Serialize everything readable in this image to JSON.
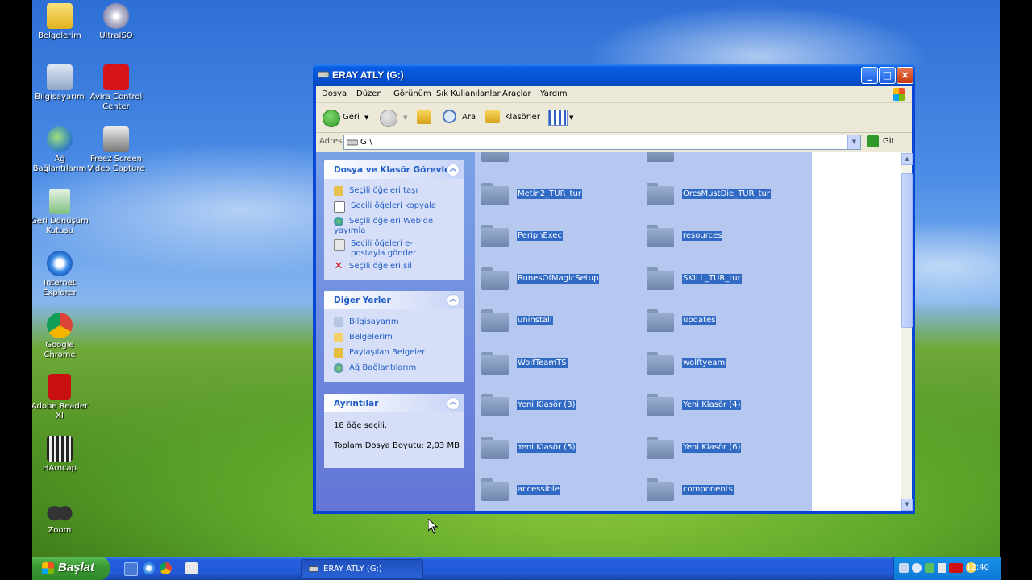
{
  "desktop": {
    "icons": [
      {
        "label": "Belgelerim",
        "icon": "my-documents-icon"
      },
      {
        "label": "UltraISO",
        "icon": "ultraiso-icon"
      },
      {
        "label": "Bilgisayarım",
        "icon": "my-computer-icon"
      },
      {
        "label": "Avira Control Center",
        "icon": "avira-icon"
      },
      {
        "label": "Ağ Bağlantılarım",
        "icon": "network-icon"
      },
      {
        "label": "Freez Screen Video Capture",
        "icon": "freez-screen-icon"
      },
      {
        "label": "Geri Dönüşüm Kutusu",
        "icon": "recycle-bin-icon"
      },
      {
        "label": "Internet Explorer",
        "icon": "internet-explorer-icon"
      },
      {
        "label": "Google Chrome",
        "icon": "chrome-icon"
      },
      {
        "label": "Adobe Reader XI",
        "icon": "adobe-reader-icon"
      },
      {
        "label": "HAmcap",
        "icon": "hamcap-icon"
      },
      {
        "label": "Zoom",
        "icon": "zoom-icon"
      }
    ]
  },
  "window": {
    "title": "ERAY ATLY (G:)",
    "menu": [
      "Dosya",
      "Düzen",
      "Görünüm",
      "Sık Kullanılanlar",
      "Araçlar",
      "Yardım"
    ],
    "toolbar": {
      "back": "Geri",
      "search": "Ara",
      "folders": "Klasörler"
    },
    "address": {
      "label": "Adres",
      "value": "G:\\",
      "go": "Git"
    },
    "tasks": {
      "title": "Dosya ve Klasör Görevleri",
      "items": [
        "Seçili öğeleri taşı",
        "Seçili öğeleri kopyala",
        "Seçili öğeleri Web'de yayımla",
        "Seçili öğeleri e-postayla gönder",
        "Seçili öğeleri sil"
      ]
    },
    "other_places": {
      "title": "Diğer Yerler",
      "items": [
        "Bilgisayarım",
        "Belgelerim",
        "Paylaşılan Belgeler",
        "Ağ Bağlantılarım"
      ]
    },
    "details": {
      "title": "Ayrıntılar",
      "selected": "18 öğe seçili.",
      "size": "Toplam Dosya Boyutu: 2,03 MB"
    },
    "files": [
      "Metin2_TUR_tur",
      "OrcsMustDie_TUR_tur",
      "PeriphExec",
      "resources",
      "RunesOfMagicSetup",
      "SKILL_TUR_tur",
      "uninstall",
      "updates",
      "WolfTeamTS",
      "wolftyeam",
      "Yeni Klasör (3)",
      "Yeni Klasör (4)",
      "Yeni Klasör (5)",
      "Yeni Klasör (6)",
      "accessible",
      "components"
    ]
  },
  "taskbar": {
    "start": "Başlat",
    "task": "ERAY ATLY (G:)",
    "clock": "12:40"
  }
}
